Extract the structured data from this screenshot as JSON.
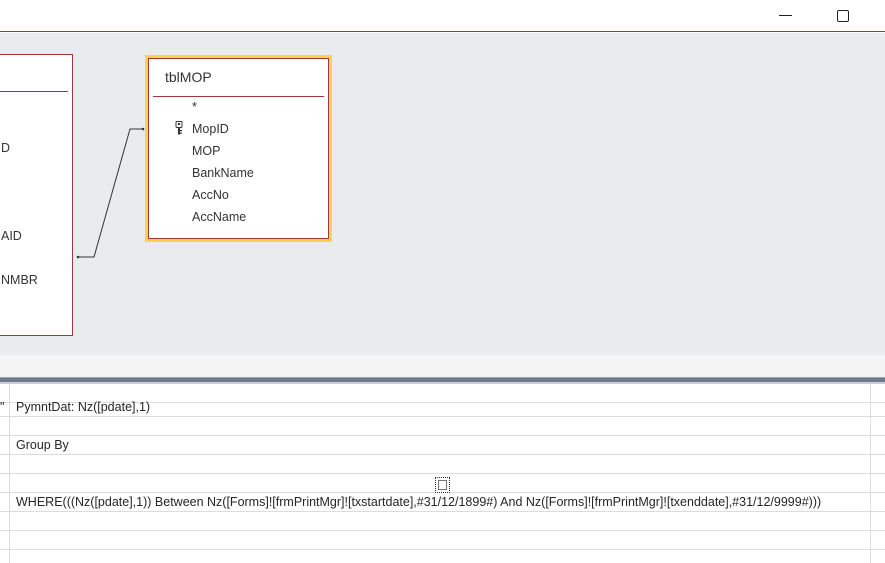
{
  "window": {
    "minimize_icon": "minimize-icon",
    "maximize_icon": "maximize-icon"
  },
  "left_table": {
    "fields": [
      "D",
      "AID",
      "NMBR"
    ]
  },
  "right_table": {
    "name": "tblMOP",
    "fields": [
      "*",
      "MopID",
      "MOP",
      "BankName",
      "AccNo",
      "AccName"
    ],
    "primary_key_field": "MopID",
    "key_icon": "key-icon"
  },
  "grid": {
    "field_prefix": "\"",
    "field": "PymntDat: Nz([pdate],1)",
    "total": "Group By",
    "criteria": "WHERE(((Nz([pdate],1)) Between Nz([Forms]![frmPrintMgr]![txstartdate],#31/12/1899#) And Nz([Forms]![frmPrintMgr]![txenddate],#31/12/9999#)))"
  },
  "colors": {
    "accent": "#a4373a",
    "selection": "#ffd04d",
    "canvas": "#e9ecef"
  }
}
